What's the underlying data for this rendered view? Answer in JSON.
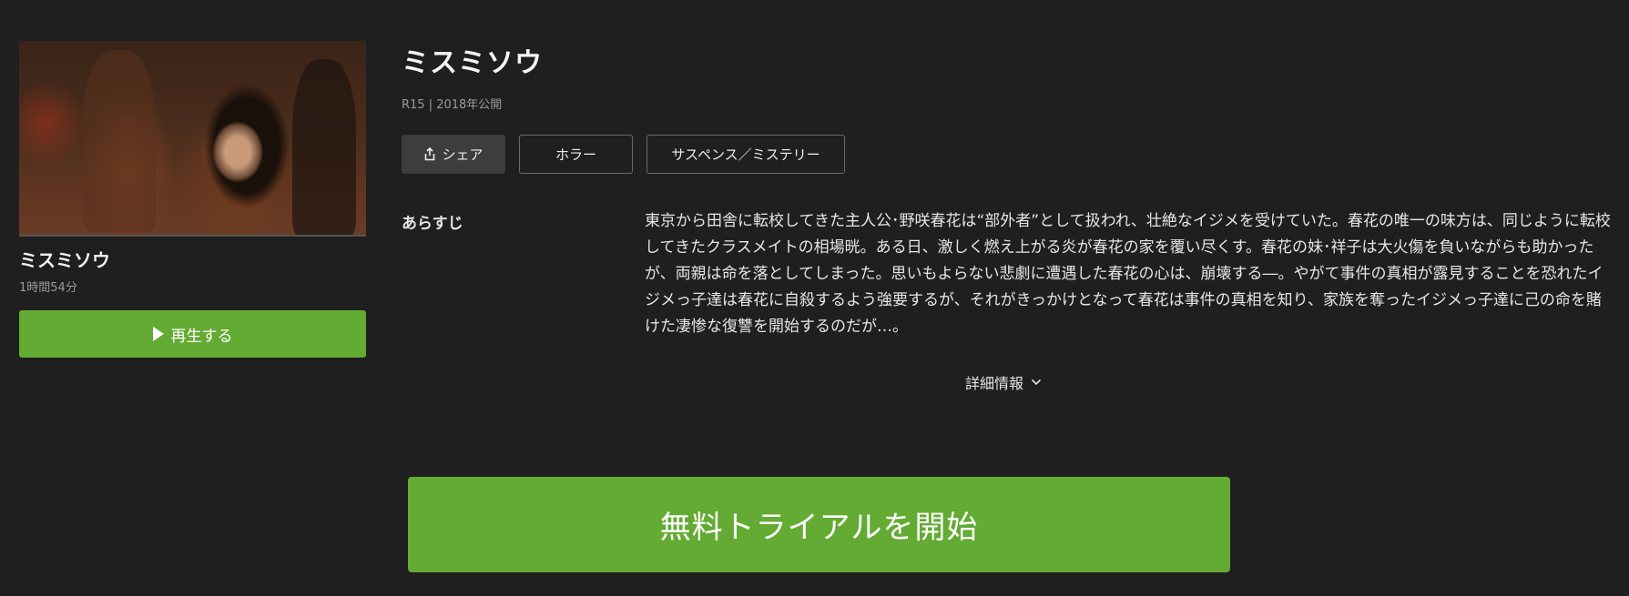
{
  "title": {
    "name": "ミスミソウ",
    "meta": "R15 | 2018年公開"
  },
  "sidebar": {
    "title": "ミスミソウ",
    "duration": "1時間54分",
    "play_label": "再生する"
  },
  "tags": {
    "share_label": "シェア",
    "genres": [
      "ホラー",
      "サスペンス／ミステリー"
    ]
  },
  "synopsis": {
    "label": "あらすじ",
    "text": "東京から田舎に転校してきた主人公･野咲春花は“部外者”として扱われ、壮絶なイジメを受けていた。春花の唯一の味方は、同じように転校してきたクラスメイトの相場晄。ある日、激しく燃え上がる炎が春花の家を覆い尽くす。春花の妹･祥子は大火傷を負いながらも助かったが、両親は命を落としてしまった。思いもよらない悲劇に遭遇した春花の心は、崩壊する―。やがて事件の真相が露見することを恐れたイジメっ子達は春花に自殺するよう強要するが、それがきっかけとなって春花は事件の真相を知り、家族を奪ったイジメっ子達に己の命を賭けた凄惨な復讐を開始するのだが…。"
  },
  "details_label": "詳細情報",
  "trial_label": "無料トライアルを開始",
  "colors": {
    "background": "#1f1f1f",
    "accent_green": "#63ab33",
    "share_bg": "#3d3d3d"
  },
  "icons": {
    "play": "play-icon",
    "share": "share-icon",
    "details": "chevron-down-icon"
  }
}
